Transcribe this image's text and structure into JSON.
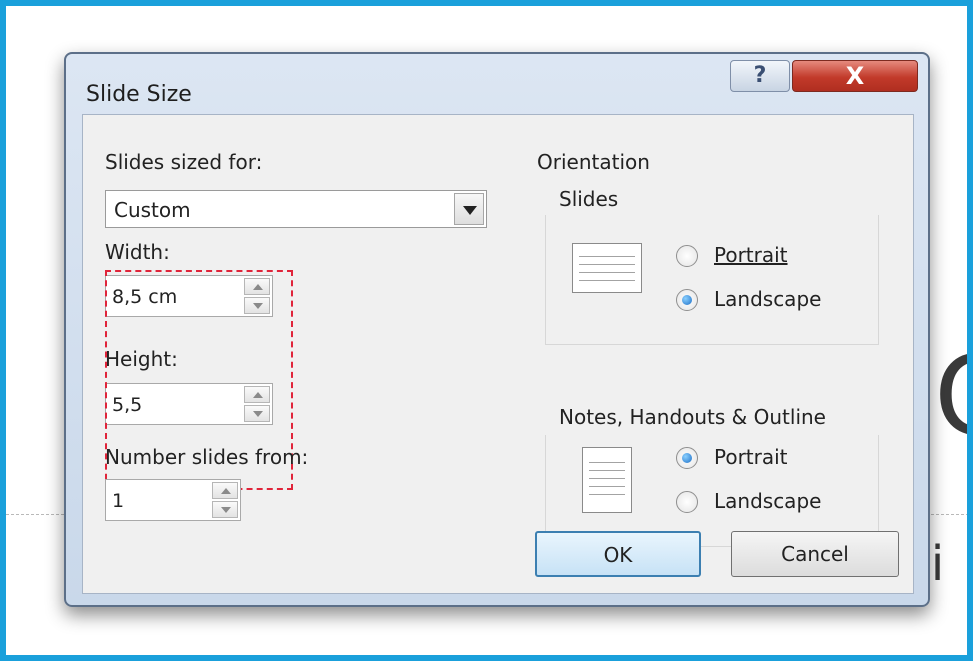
{
  "background": {
    "big_letter": "C",
    "partial_text": "ti"
  },
  "dialog": {
    "title": "Slide Size",
    "help_label": "?",
    "close_label": "X",
    "slides_sized_for": {
      "label": "Slides sized for:",
      "value": "Custom"
    },
    "width": {
      "label": "Width:",
      "value": "8,5 cm"
    },
    "height": {
      "label": "Height:",
      "value": "5,5"
    },
    "number_slides_from": {
      "label": "Number slides from:",
      "value": "1"
    },
    "orientation": {
      "label": "Orientation",
      "slides": {
        "label": "Slides",
        "options": [
          "Portrait",
          "Landscape"
        ],
        "selected": "Landscape"
      },
      "notes": {
        "label": "Notes, Handouts & Outline",
        "options": [
          "Portrait",
          "Landscape"
        ],
        "selected": "Portrait"
      }
    },
    "ok_label": "OK",
    "cancel_label": "Cancel"
  },
  "colors": {
    "frame": "#1aa0db",
    "highlight": "#e0243a",
    "close_button": "#c23a2a"
  }
}
